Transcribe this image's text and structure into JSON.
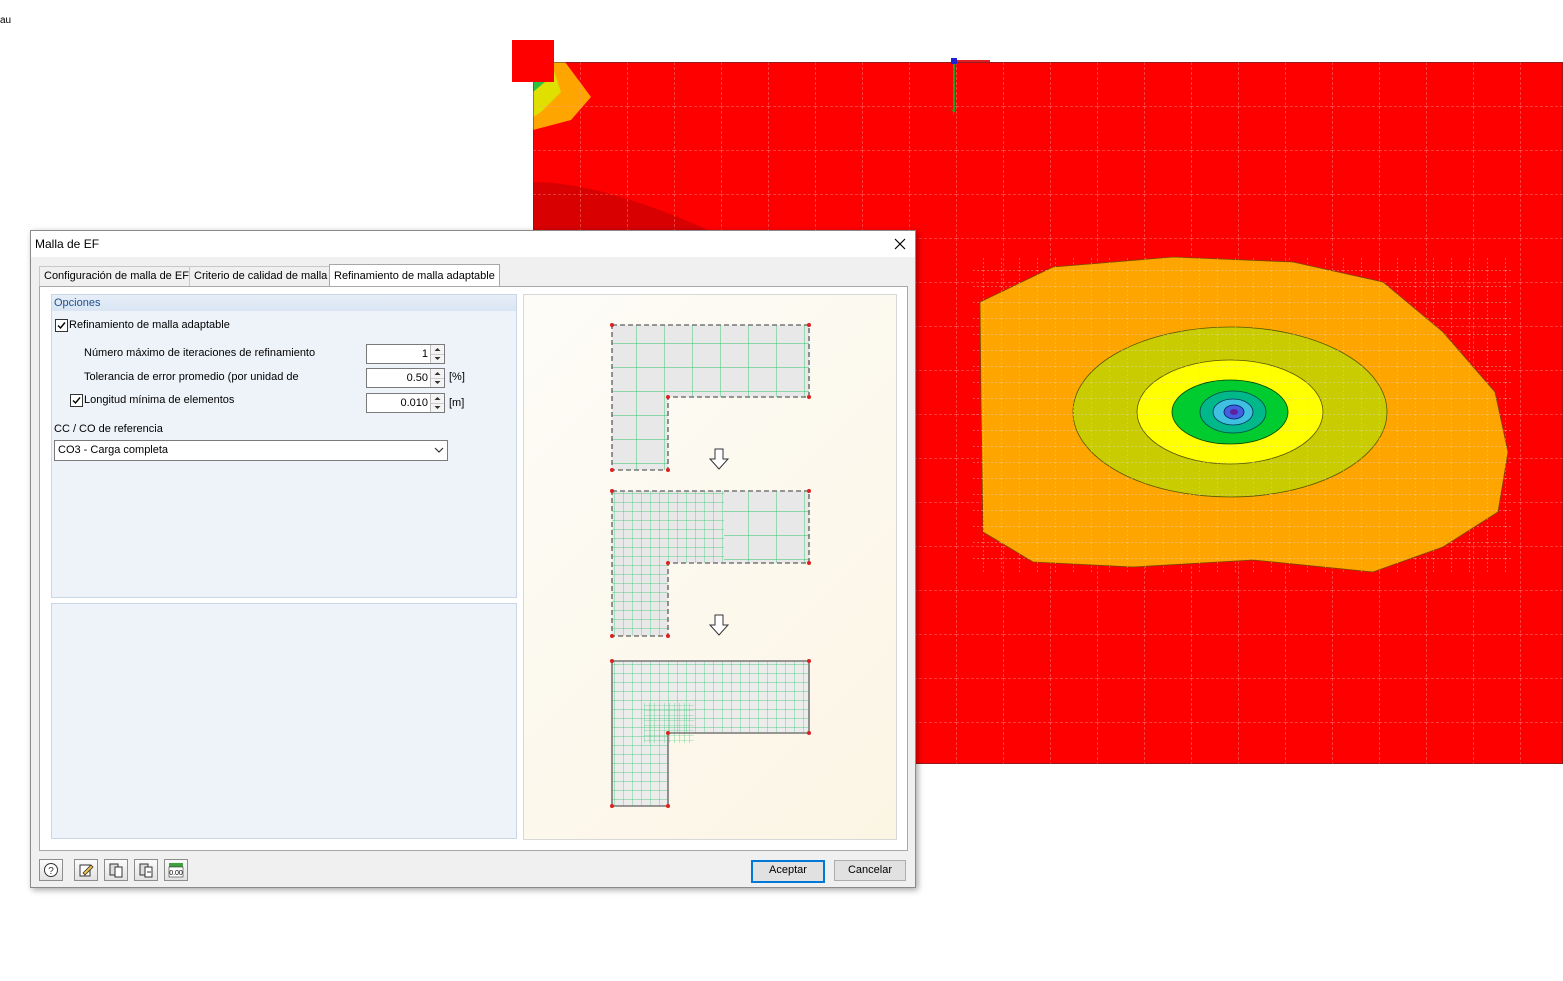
{
  "background": {
    "corner_label": "au",
    "view_axis_label": "Y"
  },
  "dialog": {
    "title": "Malla de EF",
    "tabs": [
      {
        "label": "Configuración de malla de EF"
      },
      {
        "label": "Criterio de calidad de malla"
      },
      {
        "label": "Refinamiento de malla adaptable",
        "active": true
      }
    ],
    "options": {
      "header": "Opciones",
      "adaptive_refinement": {
        "label": "Refinamiento de malla adaptable",
        "checked": true
      },
      "max_iterations": {
        "label": "Número máximo de iteraciones de refinamiento",
        "value": "1"
      },
      "error_tolerance": {
        "label": "Tolerancia de error promedio (por unidad de",
        "value": "0.50",
        "unit": "[%]"
      },
      "min_element_length": {
        "label": "Longitud mínima de elementos",
        "checked": true,
        "value": "0.010",
        "unit": "[m]"
      },
      "reference_lc": {
        "label": "CC / CO de referencia",
        "value": "CO3 - Carga completa"
      }
    },
    "buttons": {
      "ok": "Aceptar",
      "cancel": "Cancelar"
    },
    "tool_icons": [
      "help-icon",
      "edit-icon",
      "copy-from-icon",
      "copy-to-icon",
      "decimal-places-icon"
    ]
  },
  "colors": {
    "accent": "#0078d7",
    "contour_red": "#ff0000",
    "contour_orange": "#ffa500",
    "contour_olive": "#c8cc00",
    "contour_yellow": "#ffff00",
    "contour_green": "#00cc30",
    "mesh_green": "#2ec46a"
  }
}
